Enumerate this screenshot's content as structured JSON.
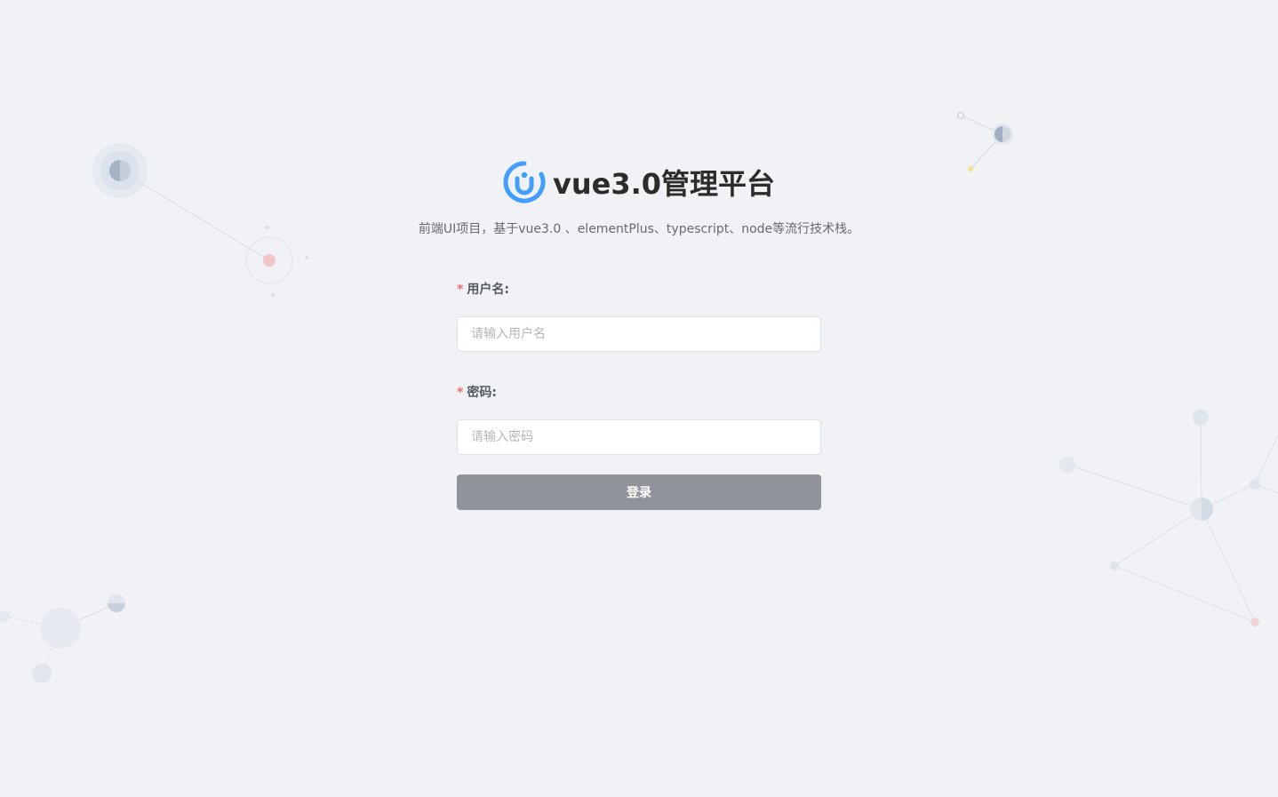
{
  "header": {
    "title": "vue3.0管理平台",
    "description": "前端UI项目，基于vue3.0 、elementPlus、typescript、node等流行技术栈。",
    "logo_icon": "vue-admin-logo-icon"
  },
  "form": {
    "username": {
      "required_mark": "*",
      "label": "用户名:",
      "placeholder": "请输入用户名",
      "value": ""
    },
    "password": {
      "required_mark": "*",
      "label": "密码:",
      "placeholder": "请输入密码",
      "value": ""
    },
    "submit_label": "登录"
  },
  "colors": {
    "background": "#f0f2f5",
    "accent": "#409eff",
    "required": "#f56c6c",
    "button_disabled": "#909399"
  }
}
